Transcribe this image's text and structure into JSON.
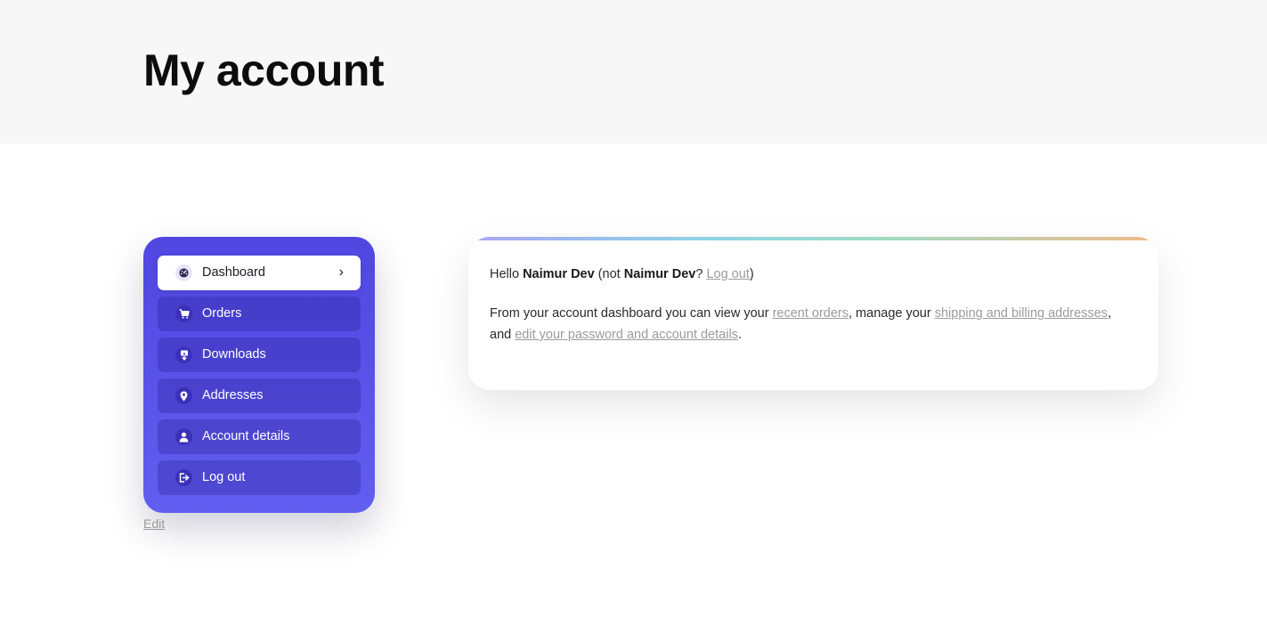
{
  "header": {
    "title": "My account"
  },
  "nav": {
    "items": [
      {
        "label": "Dashboard",
        "icon": "dashboard-icon",
        "active": true
      },
      {
        "label": "Orders",
        "icon": "cart-icon",
        "active": false
      },
      {
        "label": "Downloads",
        "icon": "download-icon",
        "active": false
      },
      {
        "label": "Addresses",
        "icon": "location-pin-icon",
        "active": false
      },
      {
        "label": "Account details",
        "icon": "user-icon",
        "active": false
      },
      {
        "label": "Log out",
        "icon": "logout-icon",
        "active": false
      }
    ],
    "active_chevron": "›",
    "edit_label": "Edit"
  },
  "dashboard": {
    "hello": "Hello",
    "user_name": "Naimur Dev",
    "not_prefix": "(not",
    "user_name_again": "Naimur Dev",
    "question": "?",
    "logout_link": "Log out",
    "close_paren": ")",
    "intro": "From your account dashboard you can view your",
    "recent_orders_link": "recent orders",
    "manage_text": ", manage your",
    "addresses_link": "shipping and billing addresses",
    "and_text": ", and",
    "account_link": "edit your password and account details",
    "period": "."
  },
  "colors": {
    "nav_gradient_top": "#5046e0",
    "nav_gradient_bottom": "#625ef0",
    "link": "#9b9b9b",
    "header_bg": "#f7f7f7"
  }
}
